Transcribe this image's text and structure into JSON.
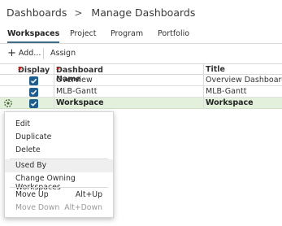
{
  "breadcrumb": {
    "root": "Dashboards",
    "separator": ">",
    "current": "Manage Dashboards"
  },
  "tabs": [
    {
      "label": "Workspaces",
      "active": true
    },
    {
      "label": "Project"
    },
    {
      "label": "Program"
    },
    {
      "label": "Portfolio"
    }
  ],
  "toolbar": {
    "add_label": "Add...",
    "assign_label": "Assign"
  },
  "table": {
    "columns": {
      "display": "Display",
      "name": "Dashboard Name",
      "title": "Title",
      "required_marker": "*"
    },
    "rows": [
      {
        "name": "Overview",
        "title": "Overview Dashboard",
        "display": true,
        "selected": false
      },
      {
        "name": "MLB-Gantt",
        "title": "MLB-Gantt",
        "display": true,
        "selected": false
      },
      {
        "name": "Workspace",
        "title": "Workspace",
        "display": true,
        "selected": true
      }
    ]
  },
  "context_menu": {
    "items": [
      {
        "label": "Edit"
      },
      {
        "label": "Duplicate"
      },
      {
        "label": "Delete"
      },
      {
        "label": "Used By"
      },
      {
        "label": "Change Owning Workspaces"
      },
      {
        "label": "Move Up",
        "shortcut": "Alt+Up"
      },
      {
        "label": "Move Down",
        "shortcut": "Alt+Down",
        "disabled": true
      }
    ]
  },
  "colors": {
    "selected_row": "#e3f1dc",
    "checkbox": "#1e5d8c",
    "required": "#d22222",
    "active_tab_underline": "#3f6f88"
  }
}
